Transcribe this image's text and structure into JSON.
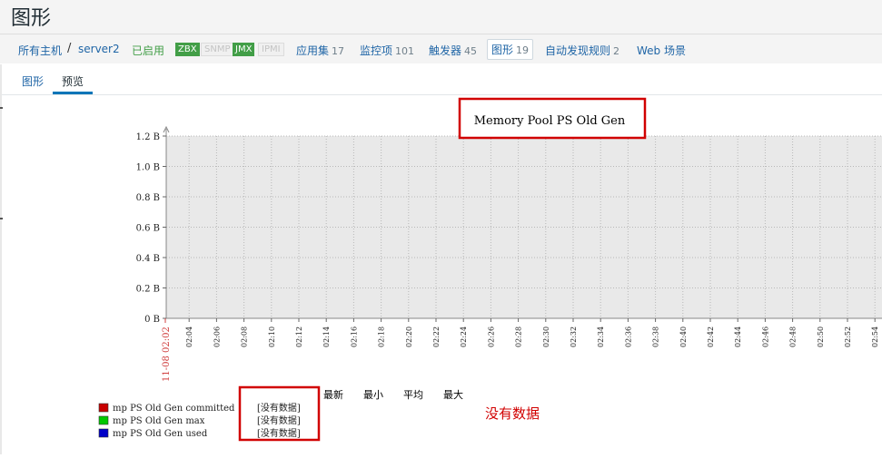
{
  "page": {
    "title": "图形"
  },
  "breadcrumb": {
    "all_hosts": "所有主机",
    "separator": "/",
    "host": "server2"
  },
  "host_status": {
    "enabled": "已启用"
  },
  "availability": [
    {
      "label": "ZBX",
      "state": "on"
    },
    {
      "label": "SNMP",
      "state": "off"
    },
    {
      "label": "JMX",
      "state": "on"
    },
    {
      "label": "IPMI",
      "state": "off"
    }
  ],
  "host_nav": {
    "applications": {
      "label": "应用集",
      "count": "17"
    },
    "items": {
      "label": "监控项",
      "count": "101"
    },
    "triggers": {
      "label": "触发器",
      "count": "45"
    },
    "graphs": {
      "label": "图形",
      "count": "19"
    },
    "discovery": {
      "label": "自动发现规则",
      "count": "2"
    },
    "web": {
      "label": "Web 场景"
    }
  },
  "tabs": {
    "graph": "图形",
    "preview": "预览"
  },
  "annotation": {
    "text": "没有数据",
    "color": "#d10000"
  },
  "chart_data": {
    "type": "line",
    "title": "Memory Pool PS Old Gen",
    "y_ticks": [
      "1.2 B",
      "1.0 B",
      "0.8 B",
      "0.6 B",
      "0.4 B",
      "0.2 B",
      "0 B"
    ],
    "ylim": [
      0,
      1.2
    ],
    "x_start_label": "11-08 02:02",
    "x_ticks": [
      "02:04",
      "02:06",
      "02:08",
      "02:10",
      "02:12",
      "02:14",
      "02:16",
      "02:18",
      "02:20",
      "02:22",
      "02:24",
      "02:26",
      "02:28",
      "02:30",
      "02:32",
      "02:34",
      "02:36",
      "02:38",
      "02:40",
      "02:42",
      "02:44",
      "02:46",
      "02:48",
      "02:50",
      "02:52",
      "02:54"
    ],
    "grid": true,
    "legend_headers": [
      "最新",
      "最小",
      "平均",
      "最大"
    ],
    "series": [
      {
        "name": "mp PS Old Gen committed",
        "color": "#c80000",
        "status": "[没有数据]",
        "values": []
      },
      {
        "name": "mp PS Old Gen max",
        "color": "#00c800",
        "status": "[没有数据]",
        "values": []
      },
      {
        "name": "mp PS Old Gen used",
        "color": "#0000c8",
        "status": "[没有数据]",
        "values": []
      }
    ]
  }
}
